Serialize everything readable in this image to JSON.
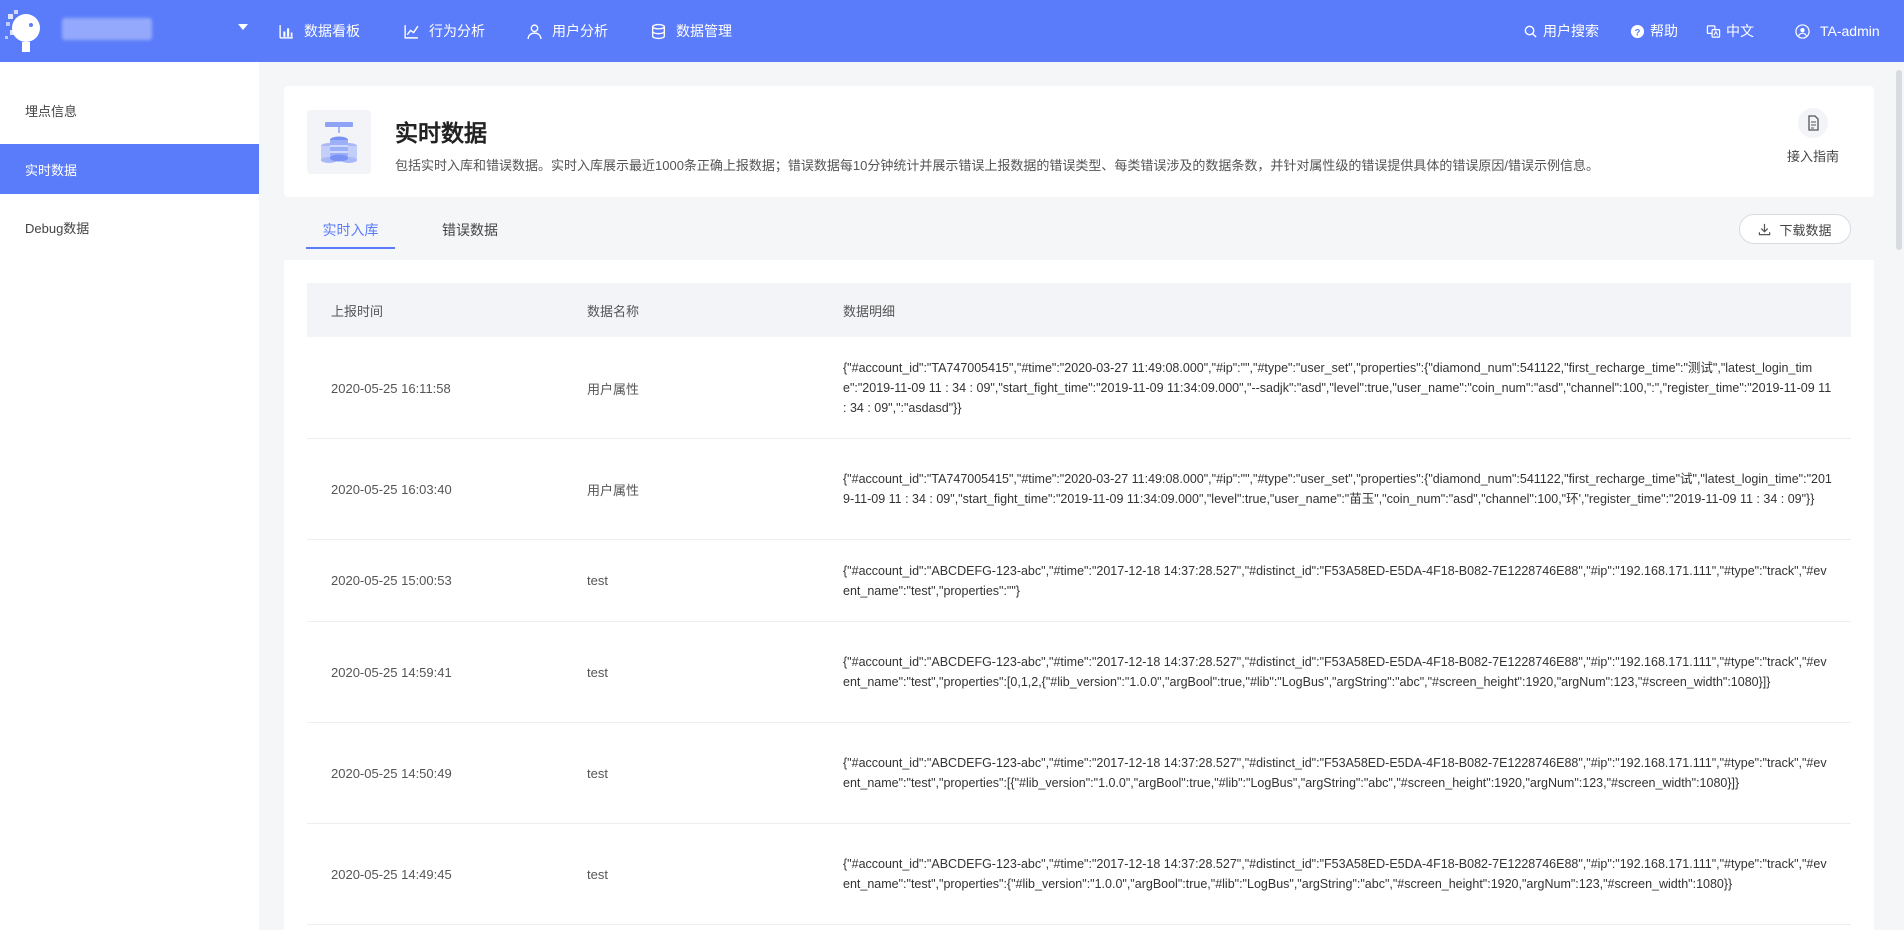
{
  "topbar": {
    "nav": [
      {
        "label": "数据看板",
        "icon": "bar-chart-icon"
      },
      {
        "label": "行为分析",
        "icon": "trend-line-icon"
      },
      {
        "label": "用户分析",
        "icon": "user-icon"
      },
      {
        "label": "数据管理",
        "icon": "database-icon"
      }
    ],
    "right": {
      "search": "用户搜索",
      "help": "帮助",
      "lang": "中文",
      "user": "TA-admin"
    }
  },
  "sidebar": {
    "items": [
      {
        "label": "埋点信息"
      },
      {
        "label": "实时数据"
      },
      {
        "label": "Debug数据"
      }
    ]
  },
  "header": {
    "title": "实时数据",
    "description": "包括实时入库和错误数据。实时入库展示最近1000条正确上报数据；错误数据每10分钟统计并展示错误上报数据的错误类型、每类错误涉及的数据条数，并针对属性级的错误提供具体的错误原因/错误示例信息。",
    "guide": "接入指南"
  },
  "tabs": {
    "realtime": "实时入库",
    "error": "错误数据",
    "download": "下载数据"
  },
  "table": {
    "columns": [
      "上报时间",
      "数据名称",
      "数据明细"
    ],
    "rows": [
      {
        "time": "2020-05-25 16:11:58",
        "name": "用户属性",
        "detail": "{\"#account_id\":\"TA747005415\",\"#time\":\"2020-03-27 11:49:08.000\",\"#ip\":\"\",\"#type\":\"user_set\",\"properties\":{\"diamond_num\":541122,\"first_recharge_time\":\"测试\",\"latest_login_time\":\"2019-11-09 11 : 34 : 09\",\"start_fight_time\":\"2019-11-09 11:34:09.000\",\"--sadjk\":\"asd\",\"level\":true,\"user_name\":\"coin_num\":\"asd\",\"channel\":100,\":\",\"register_time\":\"2019-11-09 11 : 34 : 09\",\":\"asdasd\"}}"
      },
      {
        "time": "2020-05-25 16:03:40",
        "name": "用户属性",
        "detail": "{\"#account_id\":\"TA747005415\",\"#time\":\"2020-03-27 11:49:08.000\",\"#ip\":\"\",\"#type\":\"user_set\",\"properties\":{\"diamond_num\":541122,\"first_recharge_time\"试\",\"latest_login_time\":\"2019-11-09 11 : 34 : 09\",\"start_fight_time\":\"2019-11-09 11:34:09.000\",\"level\":true,\"user_name\":\"苗玉\",\"coin_num\":\"asd\",\"channel\":100,\"环',\"register_time\":\"2019-11-09 11 : 34 : 09\"}}"
      },
      {
        "time": "2020-05-25 15:00:53",
        "name": "test",
        "detail": "{\"#account_id\":\"ABCDEFG-123-abc\",\"#time\":\"2017-12-18 14:37:28.527\",\"#distinct_id\":\"F53A58ED-E5DA-4F18-B082-7E1228746E88\",\"#ip\":\"192.168.171.111\",\"#type\":\"track\",\"#event_name\":\"test\",\"properties\":\"\"}"
      },
      {
        "time": "2020-05-25 14:59:41",
        "name": "test",
        "detail": "{\"#account_id\":\"ABCDEFG-123-abc\",\"#time\":\"2017-12-18 14:37:28.527\",\"#distinct_id\":\"F53A58ED-E5DA-4F18-B082-7E1228746E88\",\"#ip\":\"192.168.171.111\",\"#type\":\"track\",\"#event_name\":\"test\",\"properties\":[0,1,2,{\"#lib_version\":\"1.0.0\",\"argBool\":true,\"#lib\":\"LogBus\",\"argString\":\"abc\",\"#screen_height\":1920,\"argNum\":123,\"#screen_width\":1080}]}"
      },
      {
        "time": "2020-05-25 14:50:49",
        "name": "test",
        "detail": "{\"#account_id\":\"ABCDEFG-123-abc\",\"#time\":\"2017-12-18 14:37:28.527\",\"#distinct_id\":\"F53A58ED-E5DA-4F18-B082-7E1228746E88\",\"#ip\":\"192.168.171.111\",\"#type\":\"track\",\"#event_name\":\"test\",\"properties\":[{\"#lib_version\":\"1.0.0\",\"argBool\":true,\"#lib\":\"LogBus\",\"argString\":\"abc\",\"#screen_height\":1920,\"argNum\":123,\"#screen_width\":1080}]}"
      },
      {
        "time": "2020-05-25 14:49:45",
        "name": "test",
        "detail": "{\"#account_id\":\"ABCDEFG-123-abc\",\"#time\":\"2017-12-18 14:37:28.527\",\"#distinct_id\":\"F53A58ED-E5DA-4F18-B082-7E1228746E88\",\"#ip\":\"192.168.171.111\",\"#type\":\"track\",\"#event_name\":\"test\",\"properties\":{\"#lib_version\":\"1.0.0\",\"argBool\":true,\"#lib\":\"LogBus\",\"argString\":\"abc\",\"#screen_height\":1920,\"argNum\":123,\"#screen_width\":1080}}"
      }
    ]
  },
  "colors": {
    "accent": "#5b7cfa",
    "background": "#f5f6f8"
  }
}
